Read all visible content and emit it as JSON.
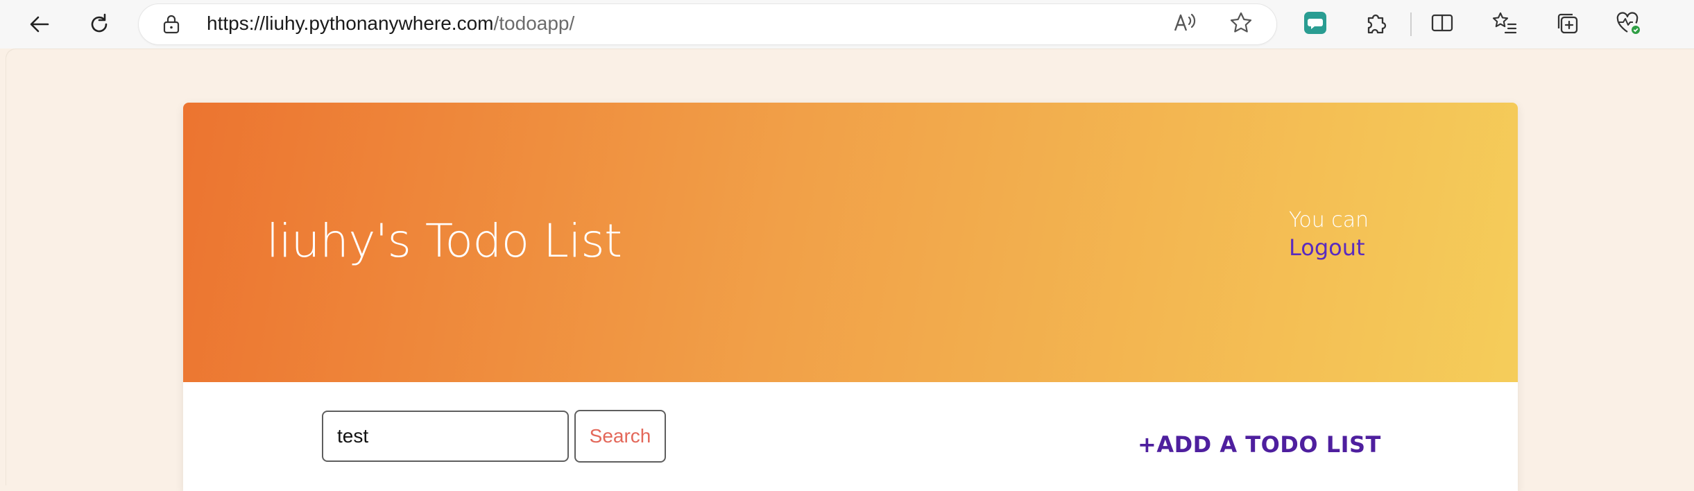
{
  "browser": {
    "url_host": "https://liuhy.pythonanywhere.com",
    "url_path": "/todoapp/",
    "icons": {
      "back": "back-arrow-icon",
      "refresh": "refresh-icon",
      "lock": "lock-icon",
      "read_aloud": "read-aloud-icon",
      "favorite": "star-icon",
      "extension_chat": "chat-extension-icon",
      "extensions": "puzzle-icon",
      "split_screen": "split-screen-icon",
      "favorites": "favorites-list-icon",
      "collections": "collections-icon",
      "health": "browser-health-icon"
    }
  },
  "hero": {
    "title": "liuhy's Todo List",
    "note": "You can",
    "logout_label": "Logout"
  },
  "search": {
    "value": "test",
    "button_label": "Search"
  },
  "actions": {
    "add_todo_label": "+ADD A TODO LIST"
  },
  "colors": {
    "gradient_start": "#ec7430",
    "gradient_end": "#f5cd5a",
    "accent_purple": "#4e1f9e",
    "link_purple": "#5a2bbf",
    "search_text": "#e3685a",
    "page_bg": "#faf0e6"
  }
}
